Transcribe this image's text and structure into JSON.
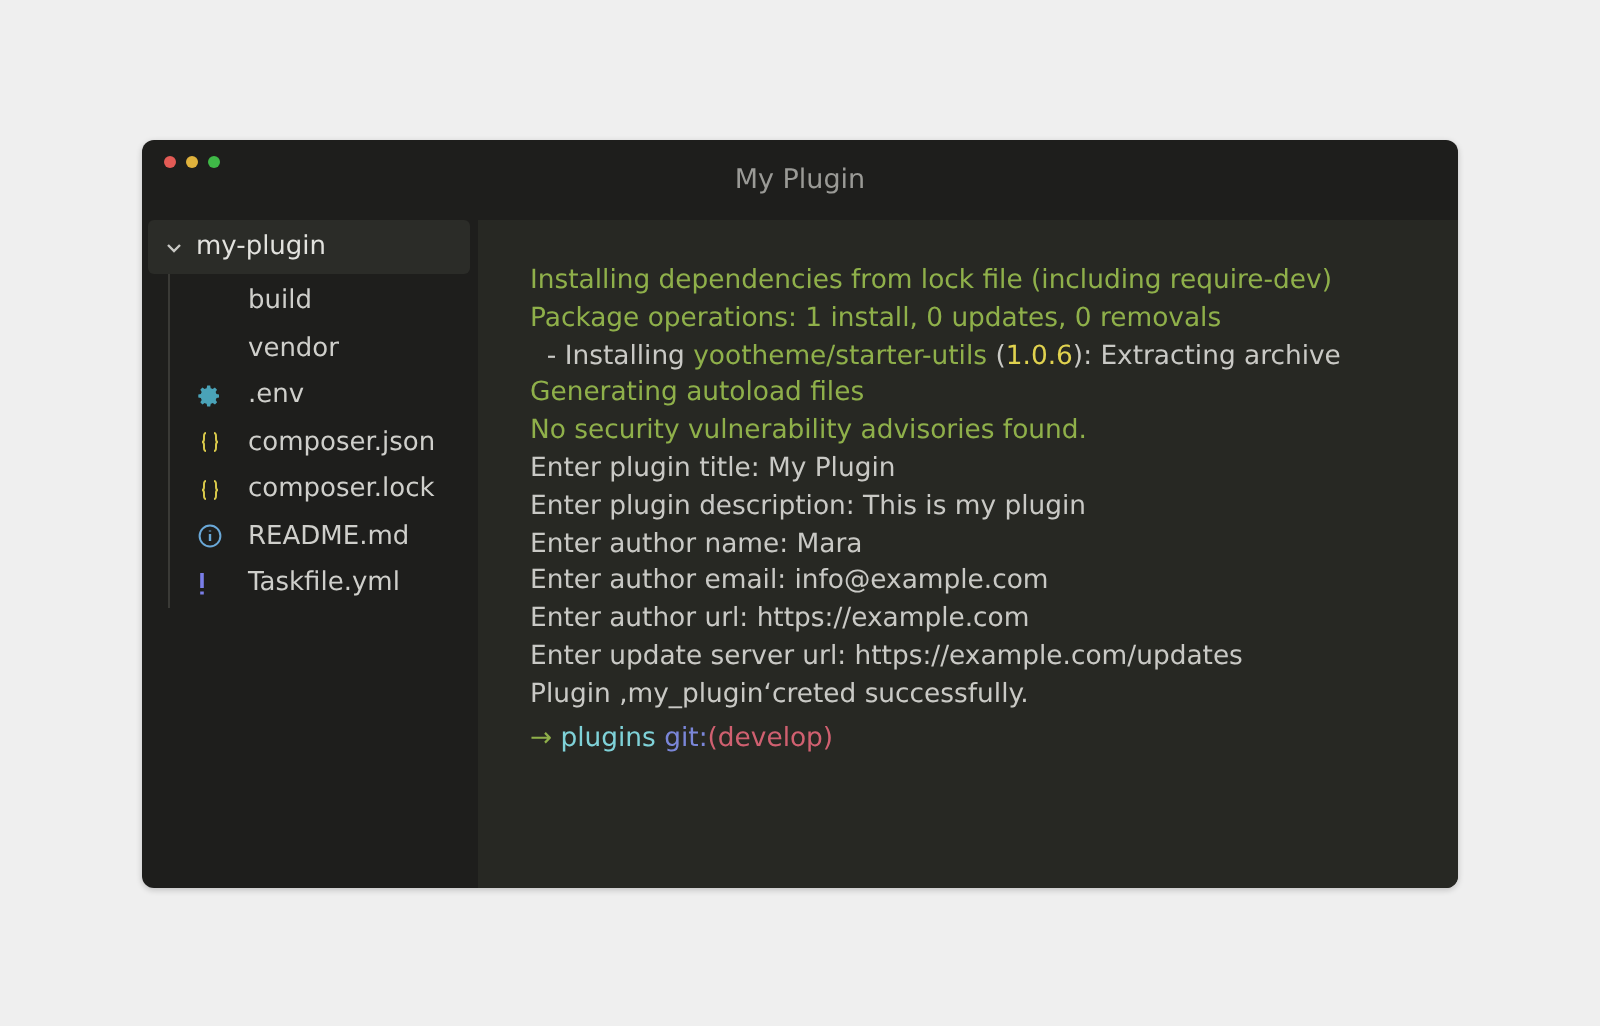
{
  "window": {
    "title": "My Plugin"
  },
  "sidebar": {
    "root": {
      "label": "my-plugin",
      "expanded": true,
      "selected": true,
      "children": [
        {
          "label": "build",
          "kind": "folder",
          "selected": false
        },
        {
          "label": "vendor",
          "kind": "folder",
          "selected": false
        },
        {
          "label": ".env",
          "kind": "config",
          "selected": false
        },
        {
          "label": "composer.json",
          "kind": "json",
          "selected": false
        },
        {
          "label": "composer.lock",
          "kind": "json",
          "selected": false
        },
        {
          "label": "README.md",
          "kind": "info",
          "selected": false
        },
        {
          "label": "Taskfile.yml",
          "kind": "yaml",
          "selected": false
        }
      ]
    }
  },
  "terminal": {
    "lines": [
      [
        {
          "kind": "ok",
          "text": "Installing dependencies from lock file (including require-dev)"
        }
      ],
      [
        {
          "kind": "ok",
          "text": "Package operations: 1 install, 0 updates, 0 removals"
        }
      ],
      [
        {
          "kind": "plain",
          "text": "  - Installing "
        },
        {
          "kind": "ok",
          "text": "yootheme/starter-utils"
        },
        {
          "kind": "plain",
          "text": " ("
        },
        {
          "kind": "version",
          "text": "1.0.6"
        },
        {
          "kind": "plain",
          "text": "): Extracting archive"
        }
      ],
      [
        {
          "kind": "ok",
          "text": "Generating autoload files"
        }
      ],
      [
        {
          "kind": "ok",
          "text": "No security vulnerability advisories found."
        }
      ],
      [
        {
          "kind": "plain",
          "text": "Enter plugin title: My Plugin"
        }
      ],
      [
        {
          "kind": "plain",
          "text": "Enter plugin description: This is my plugin"
        }
      ],
      [
        {
          "kind": "plain",
          "text": "Enter author name: Mara"
        }
      ],
      [
        {
          "kind": "plain",
          "text": "Enter author email: info@example.com"
        }
      ],
      [
        {
          "kind": "plain",
          "text": "Enter author url: https://example.com"
        }
      ],
      [
        {
          "kind": "plain",
          "text": "Enter update server url: https://example.com/updates"
        }
      ],
      [
        {
          "kind": "plain",
          "text": "Plugin ‚my_plugin‘creted successfully."
        }
      ]
    ],
    "prompt": [
      {
        "kind": "arrow",
        "text": "→"
      },
      {
        "kind": "dir",
        "text": " plugins"
      },
      {
        "kind": "git",
        "text": " git:"
      },
      {
        "kind": "branch",
        "text": "(develop)"
      }
    ]
  }
}
